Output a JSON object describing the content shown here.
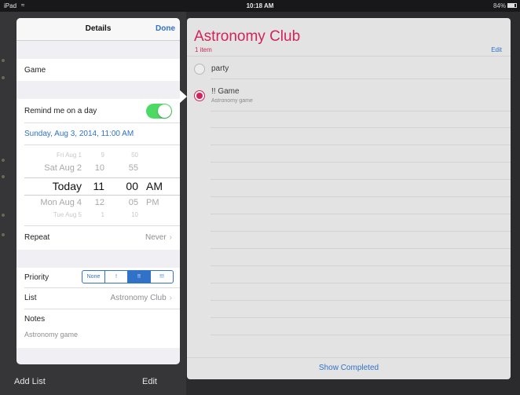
{
  "status_bar": {
    "device": "iPad",
    "wifi_icon": "wifi-icon",
    "time": "10:18 AM",
    "battery": "84%",
    "battery_level": 0.84
  },
  "sidebar": {
    "add_list": "Add List",
    "edit": "Edit"
  },
  "list": {
    "title": "Astronomy Club",
    "count": "1 item",
    "edit": "Edit",
    "tasks": [
      {
        "title": "party",
        "note": "",
        "selected": false
      },
      {
        "title": "!! Game",
        "note": "Astronomy game",
        "selected": true
      }
    ],
    "show_completed": "Show Completed",
    "accent_color": "#d0245a",
    "link_color": "#2f72c8"
  },
  "details": {
    "header_title": "Details",
    "done": "Done",
    "task_name": "Game",
    "remind_label": "Remind me on a day",
    "remind_on": true,
    "reminder_date": "Sunday, Aug 3, 2014, 11:00 AM",
    "picker_rows": [
      {
        "day": "Fri Aug 1",
        "hour": "9",
        "minute": "50",
        "ampm": ""
      },
      {
        "day": "Sat Aug 2",
        "hour": "10",
        "minute": "55",
        "ampm": ""
      },
      {
        "day": "Today",
        "hour": "11",
        "minute": "00",
        "ampm": "AM"
      },
      {
        "day": "Mon Aug 4",
        "hour": "12",
        "minute": "05",
        "ampm": "PM"
      },
      {
        "day": "Tue Aug 5",
        "hour": "1",
        "minute": "10",
        "ampm": ""
      }
    ],
    "repeat_label": "Repeat",
    "repeat_value": "Never",
    "priority_label": "Priority",
    "priority_options": [
      "None",
      "!",
      "!!",
      "!!!"
    ],
    "priority_selected": "!!",
    "list_label": "List",
    "list_value": "Astronomy Club",
    "notes_label": "Notes",
    "notes_value": "Astronomy game",
    "toggle_color": "#4cd964"
  }
}
